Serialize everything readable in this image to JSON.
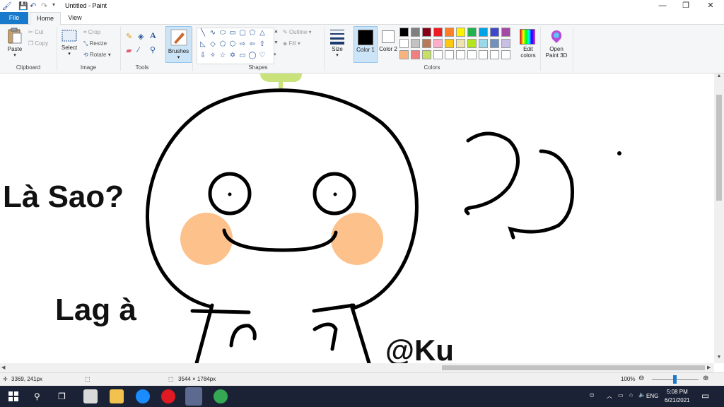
{
  "window": {
    "title": "Untitled - Paint",
    "controls": [
      "—",
      "❐",
      "✕"
    ]
  },
  "tabs": [
    {
      "label": "File"
    },
    {
      "label": "Home"
    },
    {
      "label": "View"
    }
  ],
  "ribbon": {
    "clipboard": {
      "paste": "Paste",
      "cut": "Cut",
      "copy": "Copy",
      "label": "Clipboard"
    },
    "image": {
      "select": "Select",
      "crop": "Crop",
      "resize": "Resize",
      "rotate": "Rotate",
      "label": "Image"
    },
    "tools": {
      "label": "Tools"
    },
    "brushes": {
      "label": "Brushes"
    },
    "shapes": {
      "outline": "Outline",
      "fill": "Fill",
      "label": "Shapes"
    },
    "size": {
      "label": "Size"
    },
    "color1": {
      "label": "Color 1"
    },
    "color2": {
      "label": "Color 2"
    },
    "colors": {
      "label": "Colors",
      "edit": "Edit colors"
    },
    "paint3d": {
      "label": "Open Paint 3D"
    },
    "palette_row1": [
      "#000000",
      "#7f7f7f",
      "#880015",
      "#ed1c24",
      "#ff7f27",
      "#fff200",
      "#22b14c",
      "#00a2e8",
      "#3f48cc",
      "#a349a4"
    ],
    "palette_row2": [
      "#ffffff",
      "#c3c3c3",
      "#b97a57",
      "#ffaec9",
      "#ffc90e",
      "#efe4b0",
      "#b5e61d",
      "#99d9ea",
      "#7092be",
      "#c8bfe7"
    ],
    "palette_row3": [
      "#f7b47f",
      "#f08080",
      "#c5e063",
      "#ffffff",
      "#ffffff",
      "#ffffff",
      "#ffffff",
      "#ffffff",
      "#ffffff",
      "#ffffff"
    ]
  },
  "canvas": {
    "text_la_sao": "Là Sao?",
    "text_lag_a": "Lag à",
    "text_ku": "@Ku"
  },
  "status": {
    "cursor_pos": "3369, 241px",
    "image_size": "3544 × 1784px",
    "zoom": "100%"
  },
  "taskbar": {
    "lang": "ENG",
    "time": "5:08 PM",
    "date": "6/21/2021"
  }
}
